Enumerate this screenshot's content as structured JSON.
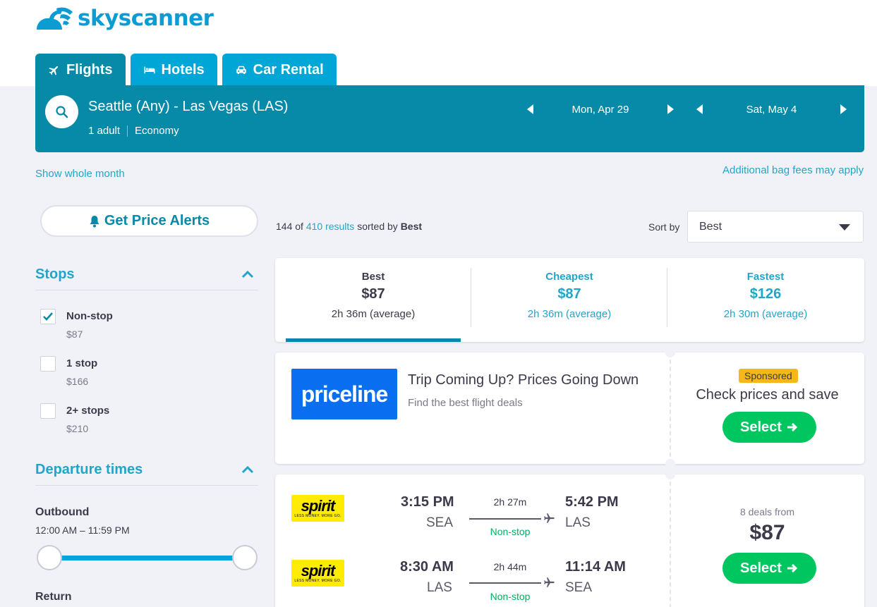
{
  "brand": {
    "name": "skyscanner",
    "color": "#0a9cd3"
  },
  "tabs": [
    {
      "label": "Flights",
      "icon": "plane-icon",
      "active": true
    },
    {
      "label": "Hotels",
      "icon": "bed-icon",
      "active": false
    },
    {
      "label": "Car Rental",
      "icon": "car-icon",
      "active": false
    }
  ],
  "search": {
    "route": "Seattle (Any) - Las Vegas (LAS)",
    "passengers": "1 adult",
    "cabin": "Economy",
    "depart_date": "Mon, Apr 29",
    "return_date": "Sat, May 4"
  },
  "links": {
    "show_month": "Show whole month",
    "bag_fees": "Additional bag fees may apply"
  },
  "sidebar": {
    "alerts_label": "Get Price Alerts",
    "stops": {
      "title": "Stops",
      "items": [
        {
          "label": "Non-stop",
          "price": "$87",
          "checked": true
        },
        {
          "label": "1 stop",
          "price": "$166",
          "checked": false
        },
        {
          "label": "2+ stops",
          "price": "$210",
          "checked": false
        }
      ]
    },
    "departure": {
      "title": "Departure times",
      "outbound_label": "Outbound",
      "outbound_range": "12:00 AM – 11:59 PM",
      "return_label": "Return"
    }
  },
  "results": {
    "shown": "144",
    "of": "of",
    "total": "410 results",
    "sorted_by": "sorted by",
    "sort": "Best",
    "sort_label": "Sort by"
  },
  "summary": [
    {
      "label": "Best",
      "price": "$87",
      "duration": "2h 36m (average)"
    },
    {
      "label": "Cheapest",
      "price": "$87",
      "duration": "2h 36m (average)"
    },
    {
      "label": "Fastest",
      "price": "$126",
      "duration": "2h 30m (average)"
    }
  ],
  "ad": {
    "logo": "priceline",
    "title": "Trip Coming Up? Prices Going Down",
    "subtitle": "Find the best flight deals",
    "badge": "Sponsored",
    "cta_text": "Check prices and save",
    "button": "Select"
  },
  "flight": {
    "deals": "8 deals from",
    "price": "$87",
    "button": "Select",
    "legs": [
      {
        "airline": "spirit",
        "tagline": "LESS MONEY. MORE GO.",
        "depart_time": "3:15 PM",
        "depart_code": "SEA",
        "duration": "2h 27m",
        "stops": "Non-stop",
        "arrive_time": "5:42 PM",
        "arrive_code": "LAS"
      },
      {
        "airline": "spirit",
        "tagline": "LESS MONEY. MORE GO.",
        "depart_time": "8:30 AM",
        "depart_code": "LAS",
        "duration": "2h 44m",
        "stops": "Non-stop",
        "arrive_time": "11:14 AM",
        "arrive_code": "SEA"
      }
    ]
  },
  "colors": {
    "teal": "#068aa8",
    "tab": "#00a6d6",
    "link": "#22a5c9",
    "green": "#00c660",
    "sponsored": "#f5b719"
  }
}
